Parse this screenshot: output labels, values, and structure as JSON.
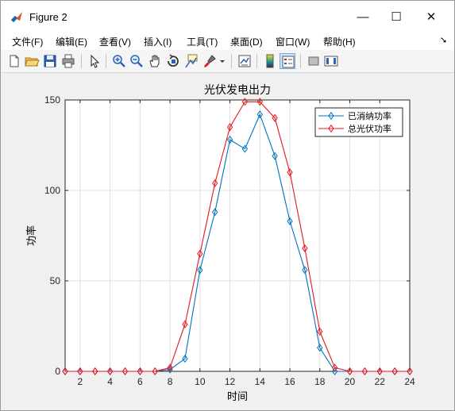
{
  "window": {
    "title": "Figure 2",
    "controls": {
      "minimize": "—",
      "maximize": "☐",
      "close": "✕"
    }
  },
  "menu": {
    "items": [
      "文件(F)",
      "编辑(E)",
      "查看(V)",
      "插入(I)",
      "工具(T)",
      "桌面(D)",
      "窗口(W)",
      "帮助(H)"
    ],
    "overflow_icon": "dock-arrow-icon"
  },
  "toolbar": {
    "buttons": [
      "new-figure-icon",
      "open-file-icon",
      "save-icon",
      "print-icon",
      "edit-plot-icon",
      "zoom-in-icon",
      "zoom-out-icon",
      "pan-icon",
      "rotate-3d-icon",
      "data-cursor-icon",
      "brush-icon",
      "link-plot-icon",
      "colorbar-icon",
      "legend-icon",
      "hide-plot-tools-icon",
      "show-plot-tools-icon"
    ],
    "active": "legend-icon"
  },
  "chart_data": {
    "type": "line",
    "title": "光伏发电出力",
    "xlabel": "时间",
    "ylabel": "功率",
    "xlim": [
      1,
      24
    ],
    "ylim": [
      0,
      150
    ],
    "xticks": [
      2,
      4,
      6,
      8,
      10,
      12,
      14,
      16,
      18,
      20,
      22,
      24
    ],
    "yticks": [
      0,
      50,
      100,
      150
    ],
    "grid": true,
    "marker": "diamond",
    "legend_position": "top-right",
    "x": [
      1,
      2,
      3,
      4,
      5,
      6,
      7,
      8,
      9,
      10,
      11,
      12,
      13,
      14,
      15,
      16,
      17,
      18,
      19,
      20,
      21,
      22,
      23,
      24
    ],
    "series": [
      {
        "name": "已消纳功率",
        "color": "#0072bd",
        "values": [
          0,
          0,
          0,
          0,
          0,
          0,
          0,
          1,
          7,
          56,
          88,
          128,
          123,
          142,
          119,
          83,
          56,
          13,
          0,
          0,
          0,
          0,
          0,
          0
        ]
      },
      {
        "name": "总光伏功率",
        "color": "#e8141c",
        "values": [
          0,
          0,
          0,
          0,
          0,
          0,
          0,
          2,
          26,
          65,
          104,
          135,
          149,
          149,
          140,
          110,
          68,
          22,
          2,
          0,
          0,
          0,
          0,
          0
        ]
      }
    ]
  }
}
